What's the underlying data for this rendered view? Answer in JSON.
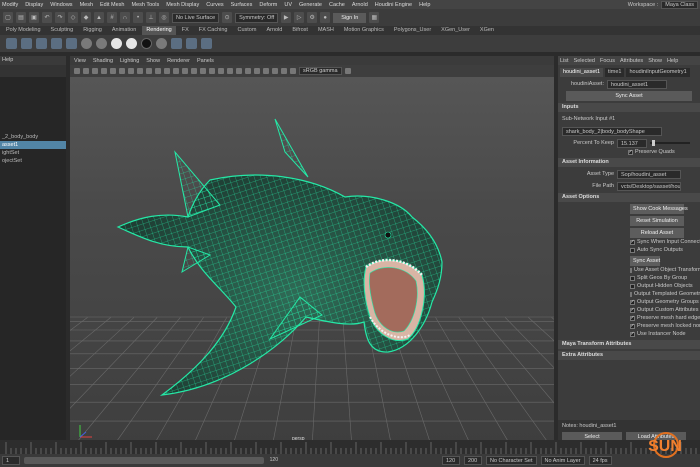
{
  "menubar": {
    "items": [
      "Modify",
      "Display",
      "Windows",
      "Mesh",
      "Edit Mesh",
      "Mesh Tools",
      "Mesh Display",
      "Curves",
      "Surfaces",
      "Deform",
      "UV",
      "Generate",
      "Cache",
      "Arnold",
      "Houdini Engine",
      "Help"
    ],
    "workspace_label": "Workspace :",
    "workspace_value": "Maya Class"
  },
  "statusline": {
    "no_live_surface": "No Live Surface",
    "symmetry": "Symmetry: Off",
    "sign_in": "Sign In"
  },
  "shelf": {
    "tabs": [
      "Poly Modeling",
      "Sculpting",
      "Rigging",
      "Animation",
      "Rendering",
      "FX",
      "FX Caching",
      "Custom",
      "Arnold",
      "Bifrost",
      "MASH",
      "Motion Graphics",
      "Polygons_User",
      "XGen_User",
      "XGen"
    ],
    "active_tab": "Rendering"
  },
  "outliner": {
    "header": "Help",
    "items": [
      "",
      "",
      "",
      "",
      "",
      "",
      "",
      "_2_body_body",
      "asset1",
      "ightSet",
      "ojectSet"
    ],
    "selected_index": 8
  },
  "viewport": {
    "menu": [
      "View",
      "Shading",
      "Lighting",
      "Show",
      "Renderer",
      "Panels"
    ],
    "gamma": "sRGB gamma",
    "camera": "persp",
    "colors": {
      "wireframe": "#25e8a6",
      "grid": "#6a6a6a"
    }
  },
  "attribute_editor": {
    "menu": [
      "List",
      "Selected",
      "Focus",
      "Attributes",
      "Show",
      "Help"
    ],
    "tabs": [
      "houdini_asset1",
      "time1",
      "houdiniInputGeometry1"
    ],
    "asset_label": "houdiniAsset:",
    "asset_value": "houdini_asset1",
    "sync_asset": "Sync Asset",
    "inputs_section": "Inputs",
    "sub_network_label": "Sub-Network Input #1",
    "sub_network_value": "shark_body_2|body_bodyShape",
    "percent_label": "Percent To Keep",
    "percent_value": "15.137",
    "preserve_quads": "Preserve Quads",
    "asset_info_section": "Asset Information",
    "asset_type_label": "Asset Type",
    "asset_type_value": "Sop/houdini_asset",
    "file_path_label": "File Path",
    "file_path_value": "vcts/Desktop/sasset/houdini",
    "asset_options_section": "Asset Options",
    "show_cook_messages": "Show Cook Messages",
    "reset_simulation": "Reset Simulation",
    "reload_asset": "Reload Asset",
    "sync_when_input": "Sync When Input Connects",
    "auto_sync_outputs": "Auto Sync Outputs",
    "sync_asset_btn": "Sync Asset",
    "options": [
      {
        "label": "Use Asset Object Transform",
        "checked": false
      },
      {
        "label": "Split Geos By Group",
        "checked": false
      },
      {
        "label": "Output Hidden Objects",
        "checked": false
      },
      {
        "label": "Output Templated Geometries",
        "checked": false
      },
      {
        "label": "Output Geometry Groups",
        "checked": true
      },
      {
        "label": "Output Custom Attributes",
        "checked": true
      },
      {
        "label": "Preserve mesh hard edges",
        "checked": true
      },
      {
        "label": "Preserve mesh locked normals",
        "checked": true
      },
      {
        "label": "Use Instancer Node",
        "checked": true
      }
    ],
    "maya_transform_section": "Maya Transform Attributes",
    "extra_attributes_section": "Extra Attributes",
    "notes_label": "Notes: houdini_asset1",
    "select_btn": "Select",
    "load_attributes_btn": "Load Attributes"
  },
  "timeline": {
    "start": "1",
    "range_end": "120",
    "frame_120": "120",
    "end": "200",
    "character_set": "No Character Set",
    "anim_layer": "No Anim Layer",
    "fps": "24 fps"
  },
  "watermark": "SUN"
}
